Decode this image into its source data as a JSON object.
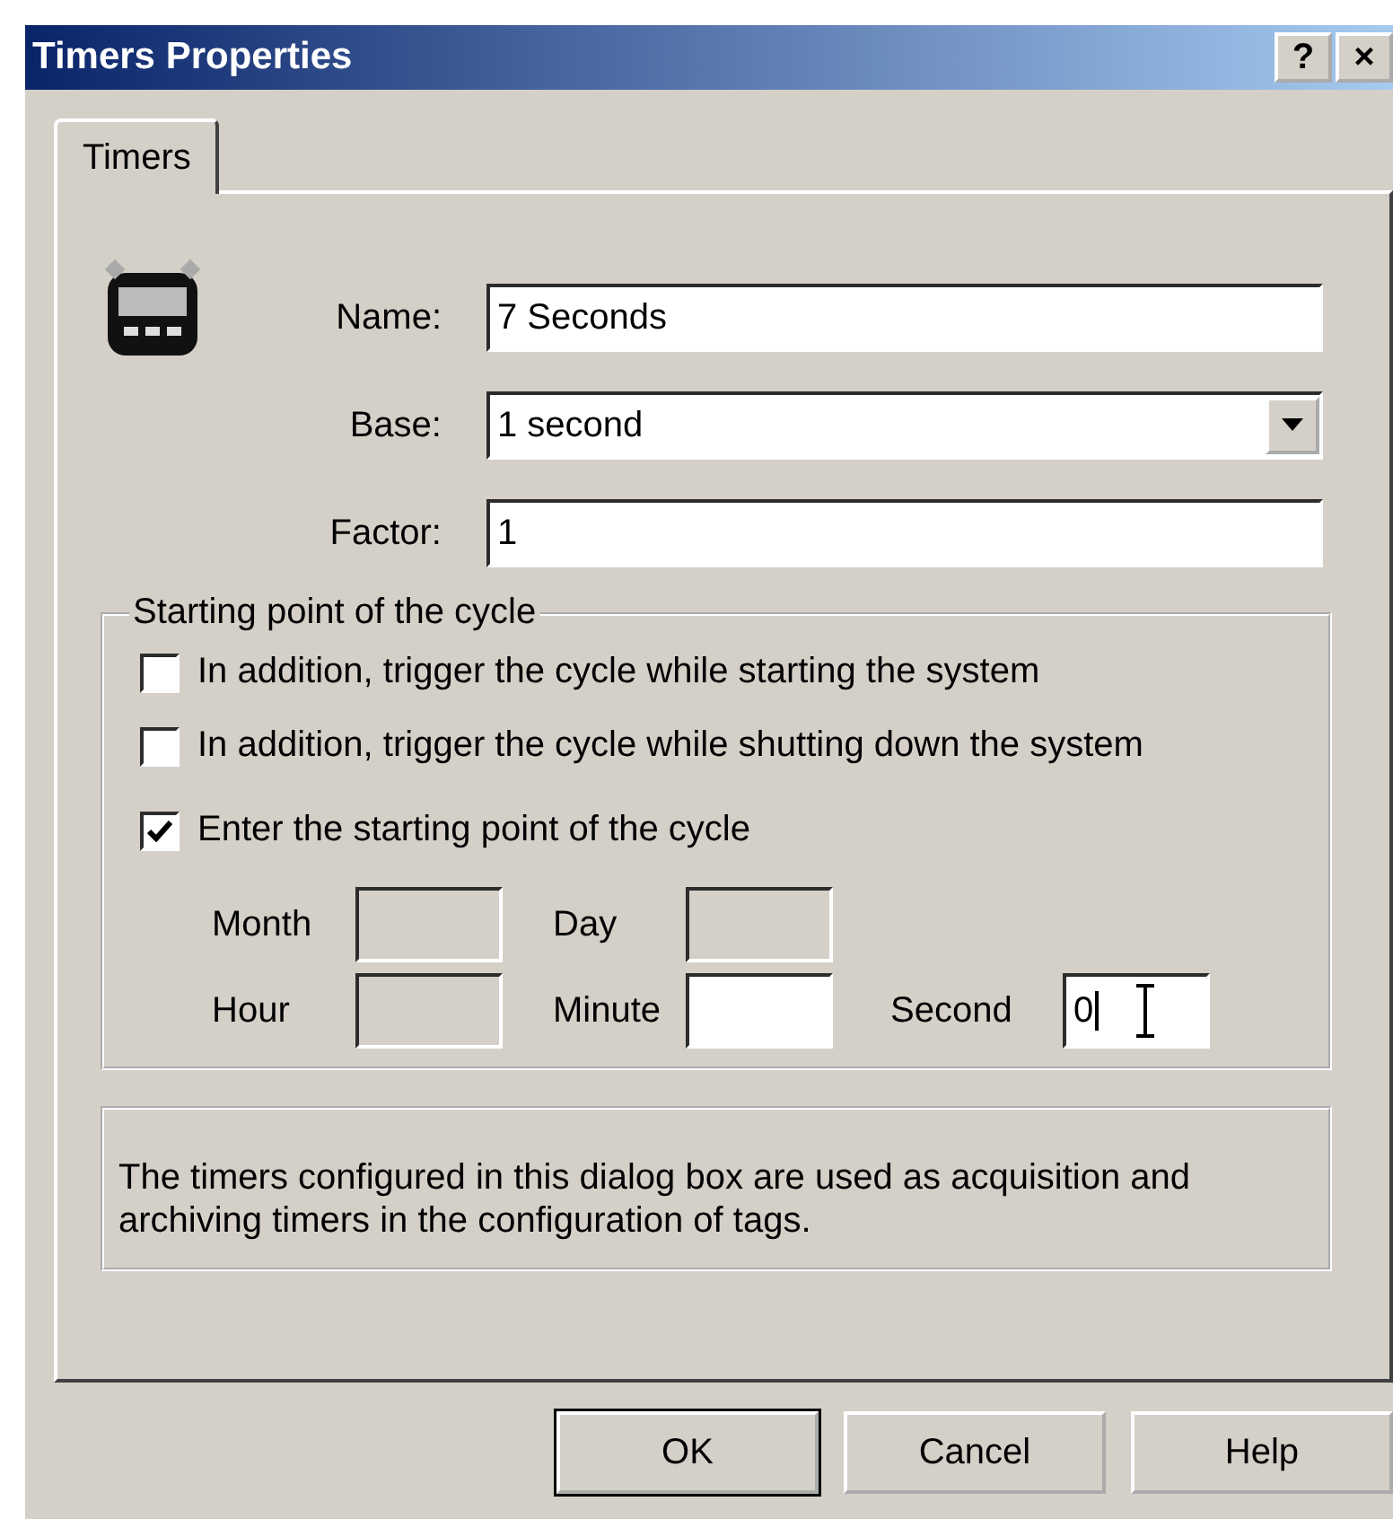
{
  "window": {
    "title": "Timers Properties",
    "title_buttons": [
      "?",
      "×"
    ]
  },
  "tabs": [
    {
      "label": "Timers",
      "selected": true
    }
  ],
  "fields": [
    {
      "kind": "text",
      "label": "Name:",
      "value": "7 Seconds"
    },
    {
      "kind": "dropdown",
      "label": "Base:",
      "value": "1 second"
    },
    {
      "kind": "text",
      "label": "Factor:",
      "value": "1"
    }
  ],
  "cycle_group": {
    "title": "Starting point of the cycle",
    "options": [
      {
        "label": "In addition, trigger the cycle while starting the system",
        "checked": false
      },
      {
        "label": "In addition, trigger the cycle while shutting down the system",
        "checked": false
      },
      {
        "label": "Enter the starting point of the cycle",
        "checked": true
      }
    ],
    "time_fields": [
      {
        "label": "Month",
        "disabled": true
      },
      {
        "label": "Day",
        "disabled": true
      },
      {
        "label": "Hour",
        "disabled": true
      },
      {
        "label": "Minute",
        "disabled": false
      },
      {
        "label": "Second",
        "disabled": false,
        "value": "0",
        "focused": true
      }
    ]
  },
  "info": "The timers configured in this dialog box are used as acquisition and archiving timers in the configuration of tags.",
  "buttons": [
    {
      "label": "OK",
      "default": true
    },
    {
      "label": "Cancel",
      "default": false
    },
    {
      "label": "Help",
      "default": false
    }
  ]
}
